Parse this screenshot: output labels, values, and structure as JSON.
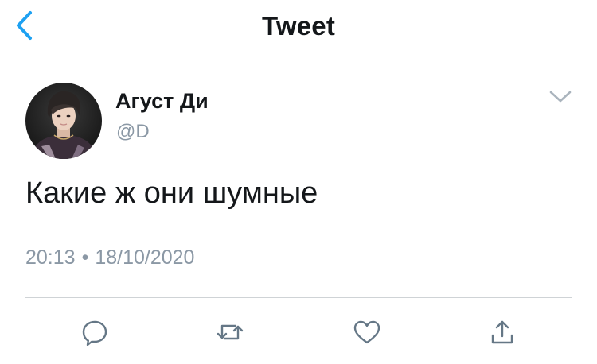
{
  "header": {
    "title": "Tweet",
    "back_icon": "chevron-left-icon"
  },
  "tweet": {
    "author": {
      "display_name": "Агуст Ди",
      "handle": "@D"
    },
    "text": "Какие ж они шумные",
    "time": "20:13",
    "separator": "•",
    "date": "18/10/2020"
  },
  "actions": [
    {
      "icon": "reply-icon"
    },
    {
      "icon": "retweet-icon"
    },
    {
      "icon": "like-icon"
    },
    {
      "icon": "share-icon"
    }
  ],
  "colors": {
    "accent": "#1da1f2",
    "text": "#14171a",
    "secondary": "#8b98a5",
    "divider": "#cfd3d6"
  }
}
